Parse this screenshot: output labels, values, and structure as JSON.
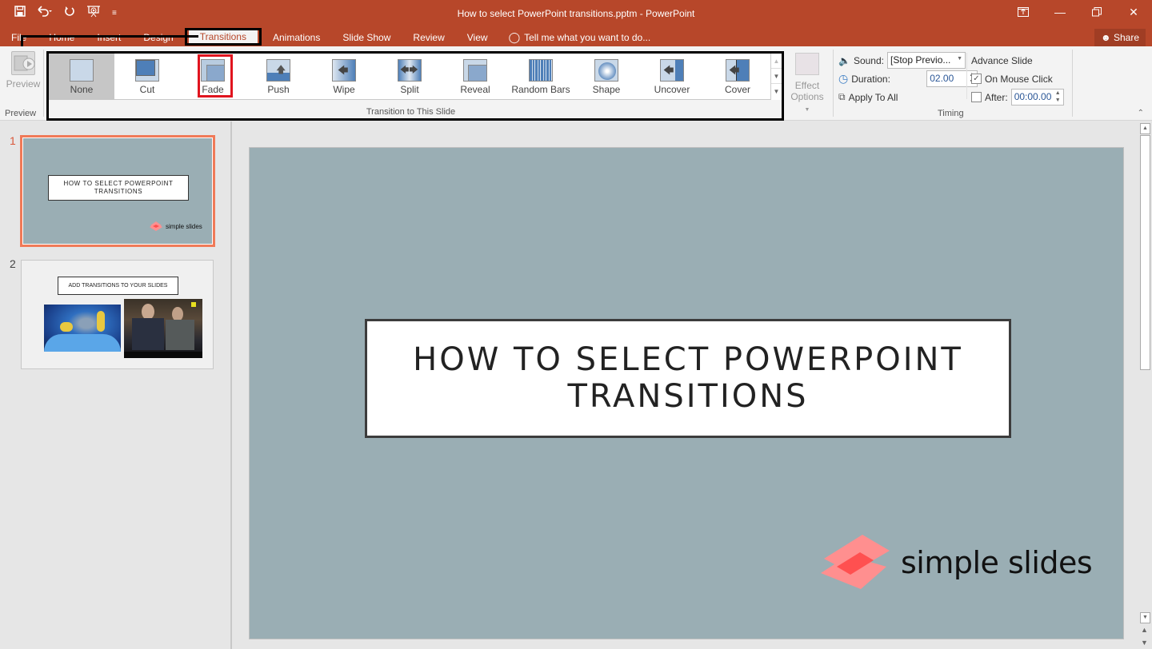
{
  "window": {
    "title": "How to select PowerPoint transitions.pptm - PowerPoint",
    "controls": [
      "ribbon-display-options",
      "minimize",
      "restore",
      "close"
    ]
  },
  "quick_access": [
    "save-icon",
    "undo-icon",
    "redo-icon",
    "start-from-beginning-icon",
    "customize-icon"
  ],
  "tabs": [
    {
      "label": "File"
    },
    {
      "label": "Home"
    },
    {
      "label": "Insert"
    },
    {
      "label": "Design"
    },
    {
      "label": "Transitions",
      "active": true
    },
    {
      "label": "Animations"
    },
    {
      "label": "Slide Show"
    },
    {
      "label": "Review"
    },
    {
      "label": "View"
    }
  ],
  "tell_me": "Tell me what you want to do...",
  "share_label": "Share",
  "ribbon": {
    "preview": {
      "button_label": "Preview",
      "group_label": "Preview"
    },
    "transitions": {
      "group_label": "Transition to This Slide",
      "items": [
        {
          "label": "None",
          "selected": true
        },
        {
          "label": "Cut"
        },
        {
          "label": "Fade",
          "highlighted": true
        },
        {
          "label": "Push"
        },
        {
          "label": "Wipe"
        },
        {
          "label": "Split"
        },
        {
          "label": "Reveal"
        },
        {
          "label": "Random Bars"
        },
        {
          "label": "Shape"
        },
        {
          "label": "Uncover"
        },
        {
          "label": "Cover"
        }
      ]
    },
    "effect_options": {
      "line1": "Effect",
      "line2": "Options"
    },
    "timing": {
      "group_label": "Timing",
      "sound_label": "Sound:",
      "sound_value": "[Stop Previo...",
      "duration_label": "Duration:",
      "duration_value": "02.00",
      "apply_all_label": "Apply To All",
      "advance_title": "Advance Slide",
      "on_mouse_click_label": "On Mouse Click",
      "on_mouse_click_checked": true,
      "after_label": "After:",
      "after_checked": false,
      "after_value": "00:00.00"
    }
  },
  "slides": [
    {
      "number": "1",
      "title": "HOW TO SELECT POWERPOINT TRANSITIONS",
      "line1": "HOW TO SELECT POWERPOINT",
      "line2": "TRANSITIONS",
      "logo": "simple slides",
      "selected": true
    },
    {
      "number": "2",
      "title": "ADD TRANSITIONS TO YOUR SLIDES"
    }
  ],
  "main_slide": {
    "line1": "HOW TO SELECT POWERPOINT",
    "line2": "TRANSITIONS",
    "logo_text": "simple slides"
  },
  "colors": {
    "accent": "#b7472a",
    "slide_bg": "#9aaeb4",
    "highlight_red": "#e0141e",
    "selected_thumb": "#f07a58",
    "logo_pink": "#ff8f8f"
  }
}
